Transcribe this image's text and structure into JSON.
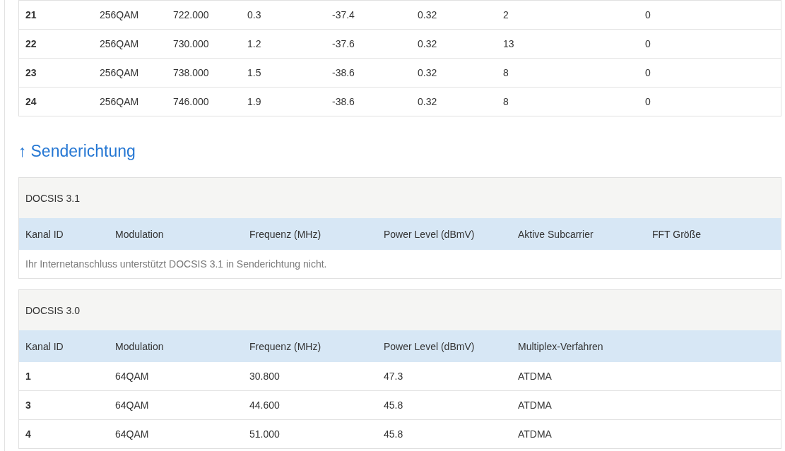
{
  "downstream_table": {
    "rows": [
      [
        "21",
        "256QAM",
        "722.000",
        "0.3",
        "-37.4",
        "0.32",
        "2",
        "0"
      ],
      [
        "22",
        "256QAM",
        "730.000",
        "1.2",
        "-37.6",
        "0.32",
        "13",
        "0"
      ],
      [
        "23",
        "256QAM",
        "738.000",
        "1.5",
        "-38.6",
        "0.32",
        "8",
        "0"
      ],
      [
        "24",
        "256QAM",
        "746.000",
        "1.9",
        "-38.6",
        "0.32",
        "8",
        "0"
      ]
    ]
  },
  "upstream": {
    "arrow": "↑",
    "title": "Senderichtung",
    "tables": [
      {
        "title": "DOCSIS 3.1",
        "columns": [
          "Kanal ID",
          "Modulation",
          "Frequenz (MHz)",
          "Power Level (dBmV)",
          "Aktive Subcarrier",
          "FFT Größe"
        ],
        "message": "Ihr Internetanschluss unterstützt DOCSIS 3.1 in Senderichtung nicht."
      },
      {
        "title": "DOCSIS 3.0",
        "columns": [
          "Kanal ID",
          "Modulation",
          "Frequenz (MHz)",
          "Power Level (dBmV)",
          "Multiplex-Verfahren"
        ],
        "rows": [
          [
            "1",
            "64QAM",
            "30.800",
            "47.3",
            "ATDMA"
          ],
          [
            "3",
            "64QAM",
            "44.600",
            "45.8",
            "ATDMA"
          ],
          [
            "4",
            "64QAM",
            "51.000",
            "45.8",
            "ATDMA"
          ]
        ]
      }
    ]
  }
}
